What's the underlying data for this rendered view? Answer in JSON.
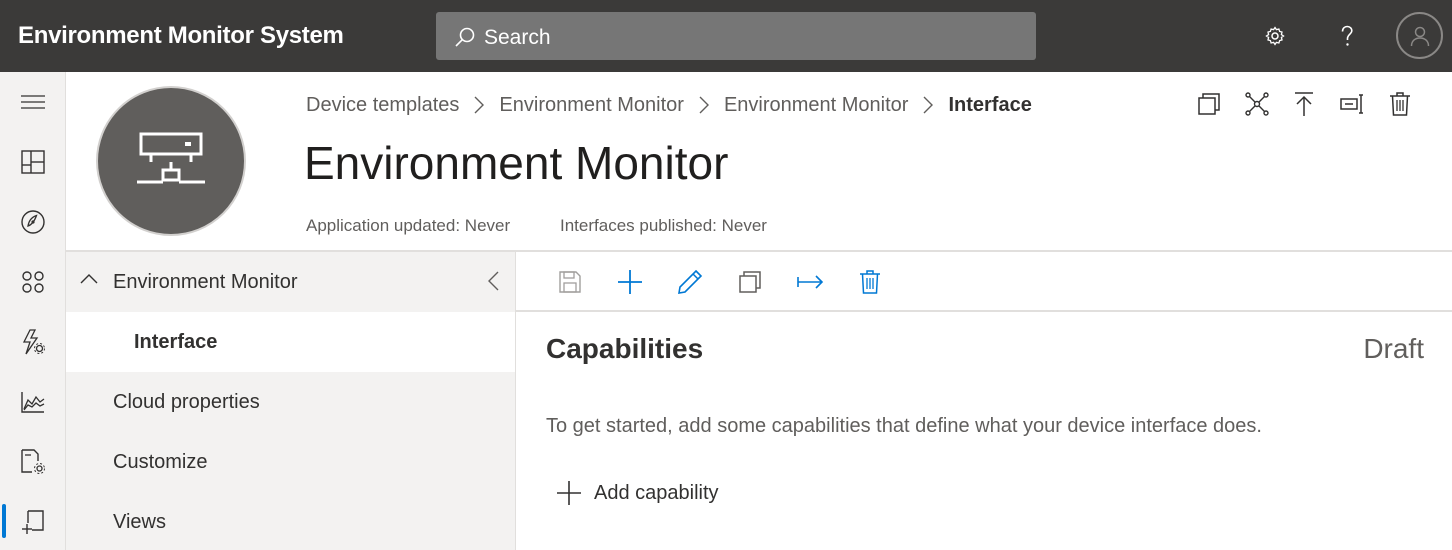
{
  "app": {
    "title": "Environment Monitor System"
  },
  "search": {
    "placeholder": "Search"
  },
  "topbar_icons": [
    "gear-icon",
    "help-icon",
    "user-avatar-icon"
  ],
  "nav_rail": [
    "hamburger-menu-icon",
    "dashboard-icon",
    "devices-icon",
    "device-groups-icon",
    "rules-icon",
    "analytics-icon",
    "jobs-icon",
    "device-templates-icon"
  ],
  "breadcrumb": {
    "items": [
      "Device templates",
      "Environment Monitor",
      "Environment Monitor"
    ],
    "current": "Interface"
  },
  "header": {
    "title": "Environment Monitor",
    "app_updated": "Application updated: Never",
    "interfaces_published": "Interfaces published: Never"
  },
  "header_tools": [
    "copy-icon",
    "connect-icon",
    "publish-icon",
    "export-icon",
    "delete-icon"
  ],
  "tree": {
    "root": "Environment Monitor",
    "selected_child": "Interface",
    "items": [
      "Cloud properties",
      "Customize",
      "Views"
    ]
  },
  "commands": [
    "save-icon",
    "add-icon",
    "edit-icon",
    "copy-icon",
    "move-icon",
    "delete-icon"
  ],
  "capabilities": {
    "title": "Capabilities",
    "status": "Draft",
    "hint": "To get started, add some capabilities that define what your device interface does.",
    "add_label": "Add capability"
  },
  "colors": {
    "topbar": "#3b3a39",
    "accent": "#0078d4",
    "search_bg": "#767676"
  }
}
